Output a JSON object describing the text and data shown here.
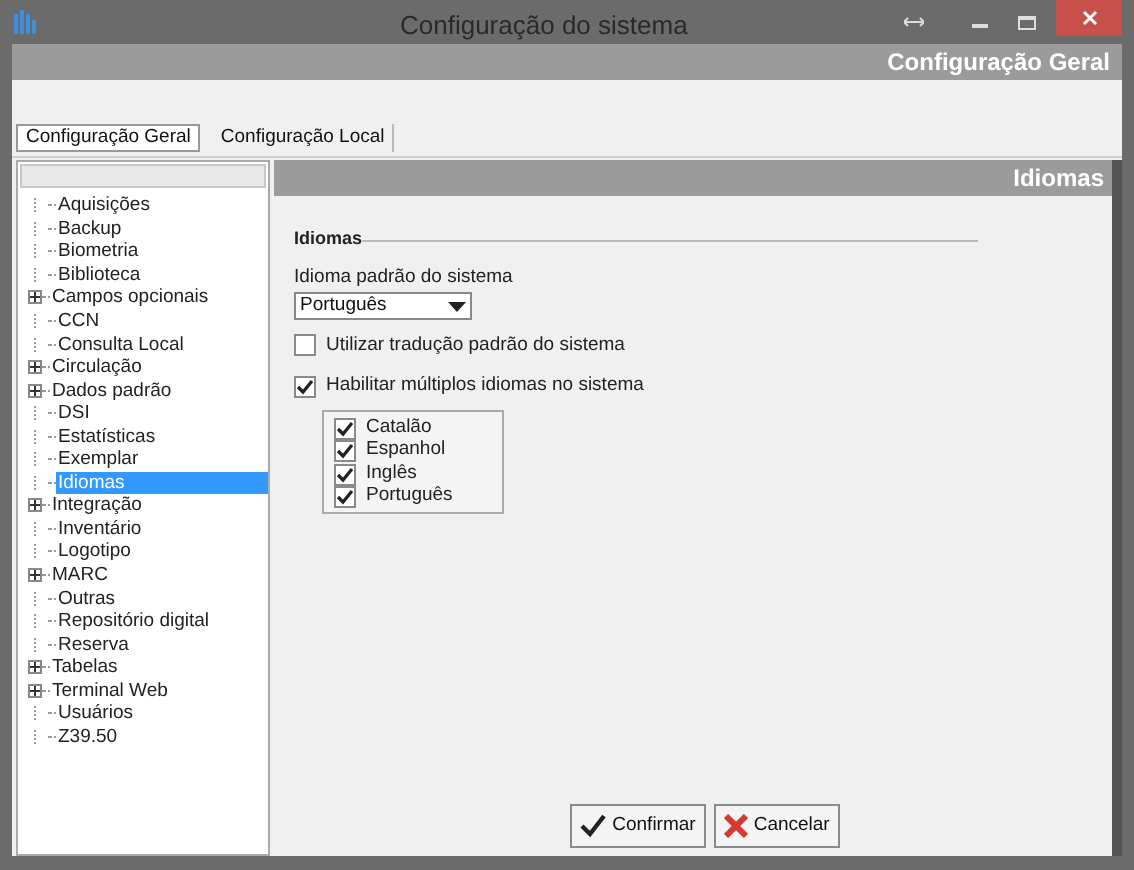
{
  "window": {
    "title": "Configuração do sistema"
  },
  "header": {
    "title": "Configuração Geral"
  },
  "tabs": [
    {
      "label": "Configuração Geral",
      "selected": true
    },
    {
      "label": "Configuração Local",
      "selected": false
    }
  ],
  "tree": {
    "items": [
      {
        "label": "Aquisições",
        "expandable": false,
        "selected": false
      },
      {
        "label": "Backup",
        "expandable": false,
        "selected": false
      },
      {
        "label": "Biometria",
        "expandable": false,
        "selected": false
      },
      {
        "label": "Biblioteca",
        "expandable": false,
        "selected": false
      },
      {
        "label": "Campos opcionais",
        "expandable": true,
        "selected": false
      },
      {
        "label": "CCN",
        "expandable": false,
        "selected": false
      },
      {
        "label": "Consulta Local",
        "expandable": false,
        "selected": false
      },
      {
        "label": "Circulação",
        "expandable": true,
        "selected": false
      },
      {
        "label": "Dados padrão",
        "expandable": true,
        "selected": false
      },
      {
        "label": "DSI",
        "expandable": false,
        "selected": false
      },
      {
        "label": "Estatísticas",
        "expandable": false,
        "selected": false
      },
      {
        "label": "Exemplar",
        "expandable": false,
        "selected": false
      },
      {
        "label": "Idiomas",
        "expandable": false,
        "selected": true
      },
      {
        "label": "Integração",
        "expandable": true,
        "selected": false
      },
      {
        "label": "Inventário",
        "expandable": false,
        "selected": false
      },
      {
        "label": "Logotipo",
        "expandable": false,
        "selected": false
      },
      {
        "label": "MARC",
        "expandable": true,
        "selected": false
      },
      {
        "label": "Outras",
        "expandable": false,
        "selected": false
      },
      {
        "label": "Repositório digital",
        "expandable": false,
        "selected": false
      },
      {
        "label": "Reserva",
        "expandable": false,
        "selected": false
      },
      {
        "label": "Tabelas",
        "expandable": true,
        "selected": false
      },
      {
        "label": "Terminal Web",
        "expandable": true,
        "selected": false
      },
      {
        "label": "Usuários",
        "expandable": false,
        "selected": false
      },
      {
        "label": "Z39.50",
        "expandable": false,
        "selected": false
      }
    ]
  },
  "panel": {
    "title": "Idiomas",
    "group": "Idiomas",
    "default_language_label": "Idioma padrão do sistema",
    "default_language": "Português",
    "options": [
      {
        "label": "Utilizar tradução padrão do sistema",
        "checked": false
      },
      {
        "label": "Habilitar múltiplos idiomas no sistema",
        "checked": true
      }
    ],
    "languages": [
      {
        "label": "Catalão",
        "checked": true
      },
      {
        "label": "Espanhol",
        "checked": true
      },
      {
        "label": "Inglês",
        "checked": true
      },
      {
        "label": "Português",
        "checked": true
      }
    ]
  },
  "buttons": [
    {
      "label": "Confirmar",
      "kind": "confirm"
    },
    {
      "label": "Cancelar",
      "kind": "cancel"
    }
  ]
}
